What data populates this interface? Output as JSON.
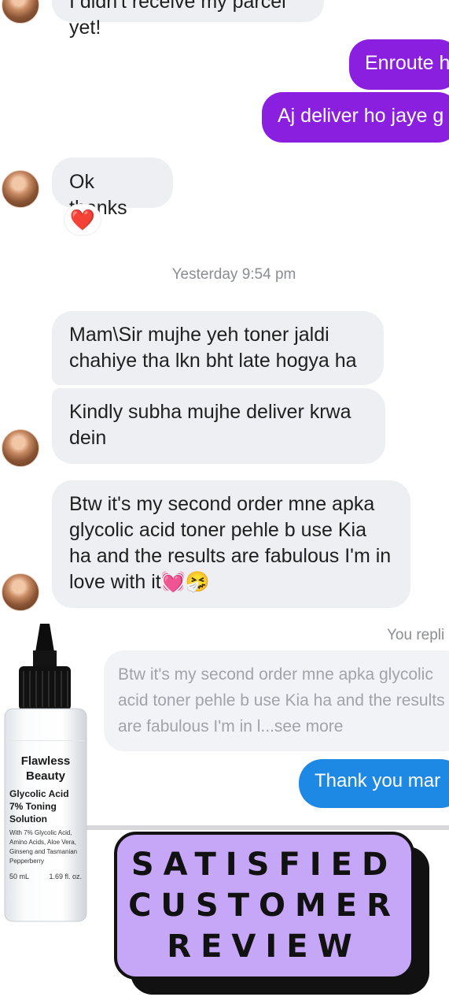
{
  "thread": {
    "cut_message": "I didn't receive my parcel yet!",
    "sent_1": "Enroute h",
    "sent_2": "Aj deliver ho jaye g",
    "reply_ok": "Ok thanks",
    "reaction": "❤️",
    "timestamp": "Yesterday 9:54 pm",
    "msg_1": "Mam\\Sir mujhe yeh toner jaldi chahiye tha lkn bht late hogya ha",
    "msg_2": "Kindly subha mujhe deliver krwa dein",
    "msg_3": "Btw it's my second order mne apka glycolic acid toner pehle b use Kia ha and the results are fabulous I'm in love with it💓🤧",
    "you_replied": "You repli",
    "quoted": "Btw it's my second order mne apka glycolic acid toner pehle b use Kia ha and the results are fabulous I'm in l...see more",
    "thank_you": "Thank you mar"
  },
  "product": {
    "brand_1": "Flawless",
    "brand_2": "Beauty",
    "name": "Glycolic Acid 7% Toning Solution",
    "ingredients": "With 7% Glycolic Acid, Amino Acids, Aloe Vera, Ginseng and Tasmanian Pepperberry",
    "volume_ml": "50 mL",
    "volume_oz": "1.69 fl. oz."
  },
  "banner": {
    "line_1": "SATISFIED",
    "line_2": "CUSTOMER",
    "line_3": "REVIEW"
  },
  "colors": {
    "sent_bubble": "#8b1fe0",
    "blue_bubble": "#1e88e5",
    "banner_bg": "#c5a6f7"
  }
}
